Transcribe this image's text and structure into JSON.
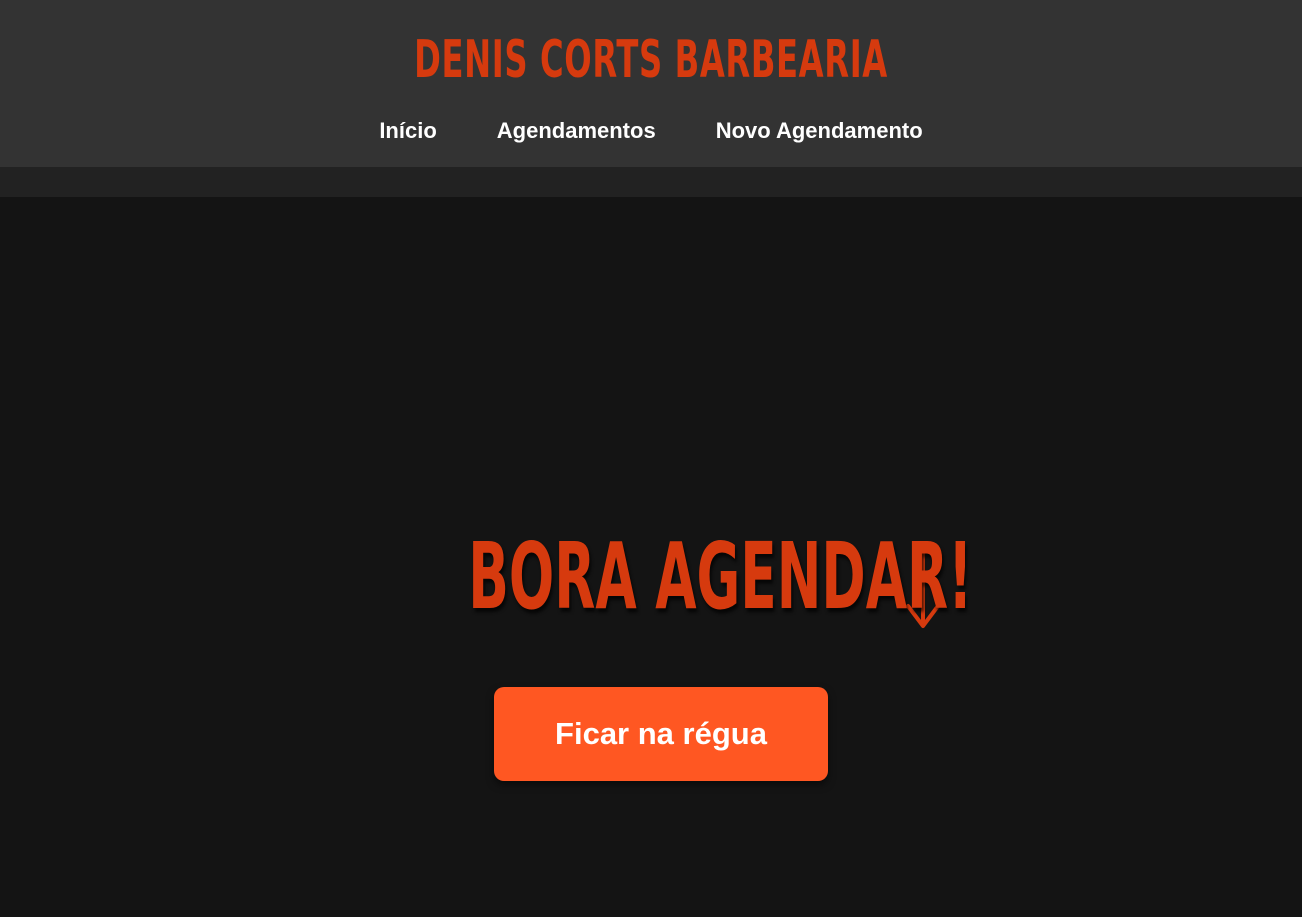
{
  "header": {
    "brand": "DENIS CORTS BARBEARIA",
    "nav": [
      {
        "label": "Início"
      },
      {
        "label": "Agendamentos"
      },
      {
        "label": "Novo Agendamento"
      }
    ]
  },
  "hero": {
    "title": "BORA AGENDAR!",
    "arrow_icon": "arrow-down-icon",
    "cta_label": "Ficar na régua"
  },
  "colors": {
    "brand_accent": "#d63a0e",
    "cta_background": "#ff5722",
    "header_background": "#333333",
    "page_background": "#141414",
    "nav_text": "#ffffff"
  }
}
